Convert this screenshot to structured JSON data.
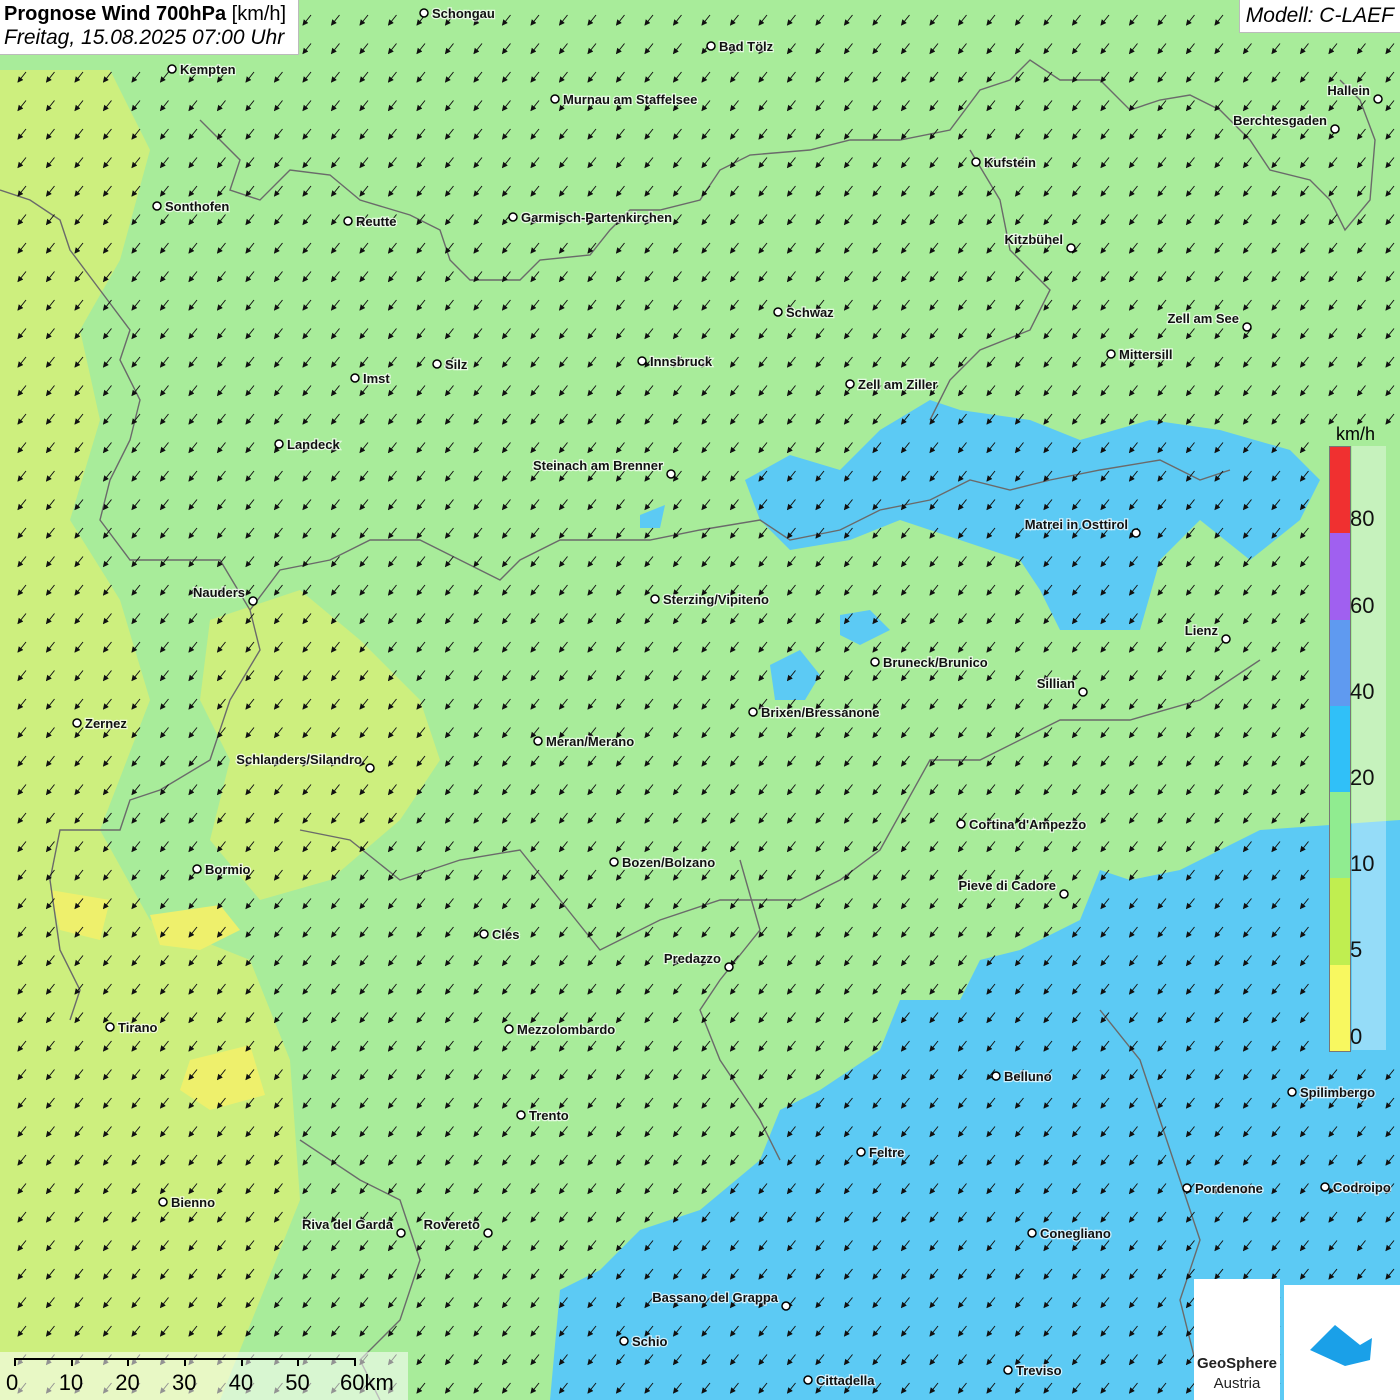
{
  "title": {
    "main": "Prognose Wind 700hPa",
    "unit": "[km/h]",
    "date": "Freitag, 15.08.2025 07:00 Uhr"
  },
  "model": "Modell: C-LAEF",
  "legend": {
    "unit": "km/h",
    "labels": [
      "80",
      "60",
      "40",
      "20",
      "10",
      "5",
      "0"
    ],
    "colors": [
      "#f03030",
      "#a060f0",
      "#5f9af0",
      "#30c0f8",
      "#90ec90",
      "#c0ee50",
      "#f8f860"
    ]
  },
  "colors": {
    "green": "#a8ec9a",
    "blue": "#5ccaf4",
    "yellowgreen": "#cdef7e",
    "yellow": "#eef06c",
    "border": "#6a6a6a",
    "arrow": "#111111"
  },
  "scale": {
    "labels": [
      "0",
      "10",
      "20",
      "30",
      "40",
      "50",
      "60km"
    ]
  },
  "logo": {
    "name1": "GeoSphere",
    "name2": "Austria"
  },
  "cities": [
    {
      "name": "Schongau",
      "label_side": "right"
    },
    {
      "name": "Bad Tölz",
      "label_side": "right"
    },
    {
      "name": "Kempten",
      "label_side": "right"
    },
    {
      "name": "Murnau am Staffelsee",
      "label_side": "right"
    },
    {
      "name": "Hallein",
      "label_side": "left"
    },
    {
      "name": "Berchtesgaden",
      "label_side": "left"
    },
    {
      "name": "Kufstein",
      "label_side": "right"
    },
    {
      "name": "Sonthofen",
      "label_side": "right"
    },
    {
      "name": "Reutte",
      "label_side": "right"
    },
    {
      "name": "Garmisch-Partenkirchen",
      "label_side": "right"
    },
    {
      "name": "Kitzbühel",
      "label_side": "left"
    },
    {
      "name": "Schwaz",
      "label_side": "right"
    },
    {
      "name": "Zell am See",
      "label_side": "left"
    },
    {
      "name": "Innsbruck",
      "label_side": "right"
    },
    {
      "name": "Silz",
      "label_side": "right"
    },
    {
      "name": "Mittersill",
      "label_side": "right"
    },
    {
      "name": "Imst",
      "label_side": "right"
    },
    {
      "name": "Zell am Ziller",
      "label_side": "right"
    },
    {
      "name": "Landeck",
      "label_side": "right"
    },
    {
      "name": "Steinach am Brenner",
      "label_side": "left"
    },
    {
      "name": "Matrei in Osttirol",
      "label_side": "left"
    },
    {
      "name": "Nauders",
      "label_side": "left"
    },
    {
      "name": "Sterzing/Vipiteno",
      "label_side": "right"
    },
    {
      "name": "Lienz",
      "label_side": "left"
    },
    {
      "name": "Bruneck/Brunico",
      "label_side": "right"
    },
    {
      "name": "Sillian",
      "label_side": "left"
    },
    {
      "name": "Brixen/Bressanone",
      "label_side": "right"
    },
    {
      "name": "Zernez",
      "label_side": "right"
    },
    {
      "name": "Meran/Merano",
      "label_side": "right"
    },
    {
      "name": "Schlanders/Silandro",
      "label_side": "left"
    },
    {
      "name": "Cortina d'Ampezzo",
      "label_side": "right"
    },
    {
      "name": "Bozen/Bolzano",
      "label_side": "right"
    },
    {
      "name": "Bormio",
      "label_side": "right"
    },
    {
      "name": "Pieve di Cadore",
      "label_side": "left"
    },
    {
      "name": "Cles",
      "label_side": "right"
    },
    {
      "name": "Predazzo",
      "label_side": "left"
    },
    {
      "name": "Tirano",
      "label_side": "right"
    },
    {
      "name": "Mezzolombardo",
      "label_side": "right"
    },
    {
      "name": "Belluno",
      "label_side": "right"
    },
    {
      "name": "Spilimbergo",
      "label_side": "right"
    },
    {
      "name": "Trento",
      "label_side": "right"
    },
    {
      "name": "Feltre",
      "label_side": "right"
    },
    {
      "name": "Pordenone",
      "label_side": "right"
    },
    {
      "name": "Codroipo",
      "label_side": "right"
    },
    {
      "name": "Bienno",
      "label_side": "right"
    },
    {
      "name": "Riva del Garda",
      "label_side": "left"
    },
    {
      "name": "Rovereto",
      "label_side": "left"
    },
    {
      "name": "Conegliano",
      "label_side": "right"
    },
    {
      "name": "Bassano del Grappa",
      "label_side": "left"
    },
    {
      "name": "Schio",
      "label_side": "right"
    },
    {
      "name": "Treviso",
      "label_side": "right"
    },
    {
      "name": "Cittadella",
      "label_side": "right"
    }
  ]
}
